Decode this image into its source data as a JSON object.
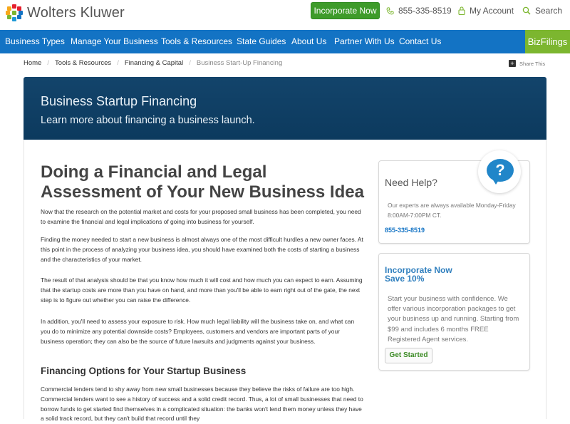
{
  "header": {
    "brand": "Wolters Kluwer",
    "incorporate_label": "Incorporate Now",
    "phone": "855-335-8519",
    "account_label": "My Account",
    "search_label": "Search",
    "colors": {
      "green": "#3e9b2a",
      "nav_blue": "#1373c4",
      "bizfilings_green": "#7cb62f"
    }
  },
  "nav": {
    "items": [
      "Business Types",
      "Manage Your Business",
      "Tools & Resources",
      "State Guides",
      "About Us",
      "Partner With Us",
      "Contact Us"
    ],
    "bizfilings": "BizFilings"
  },
  "breadcrumb": {
    "items": [
      "Home",
      "Tools & Resources",
      "Financing & Capital"
    ],
    "current": "Business Start-Up Financing",
    "share": "Share This"
  },
  "banner": {
    "title": "Business Startup Financing",
    "subtitle": "Learn more about financing a business launch."
  },
  "article": {
    "heading": "Doing a Financial and Legal Assessment of Your New Business Idea",
    "paragraphs": [
      "Now that the research on the potential market and costs for your proposed small business has been completed, you need to examine the financial and legal implications of going into business for yourself.",
      "Finding the money needed to start a new business is almost always one of the most difficult hurdles a new owner faces. At this point in the process of analyzing your business idea, you should have examined both the costs of starting a business and the characteristics of your market.",
      "The result of that analysis should be that you know how much it will cost and how much you can expect to earn. Assuming that the startup costs are more than you have on hand, and more than you'll be able to earn right out of the gate, the next step is to figure out whether you can raise the difference.",
      "In addition, you'll need to assess your exposure to risk. How much legal liability will the business take on, and what can you do to minimize any potential downside costs? Employees, customers and vendors are important parts of your business operation; they can also be the source of future lawsuits and judgments against your business."
    ],
    "subheading": "Financing Options for Your Startup Business",
    "subparagraph": "Commercial lenders tend to shy away from new small businesses because they believe the risks of failure are too high. Commercial lenders want to see a history of success and a solid credit record. Thus, a lot of small businesses that need to borrow funds to get started find themselves in a complicated situation: the banks won't lend them money unless they have a solid track record, but they can't build that record until they"
  },
  "help": {
    "title": "Need Help?",
    "text": "Our experts are always available Monday-Friday 8:00AM-7:00PM CT.",
    "phone": "855-335-8519",
    "badge_symbol": "?"
  },
  "incorporate": {
    "title_line1": "Incorporate Now",
    "title_line2": "Save 10%",
    "text": "Start your business with confidence. We offer various incorporation packages to get your business up and running. Starting from $99 and includes 6 months FREE Registered Agent services.",
    "button": "Get Started"
  }
}
